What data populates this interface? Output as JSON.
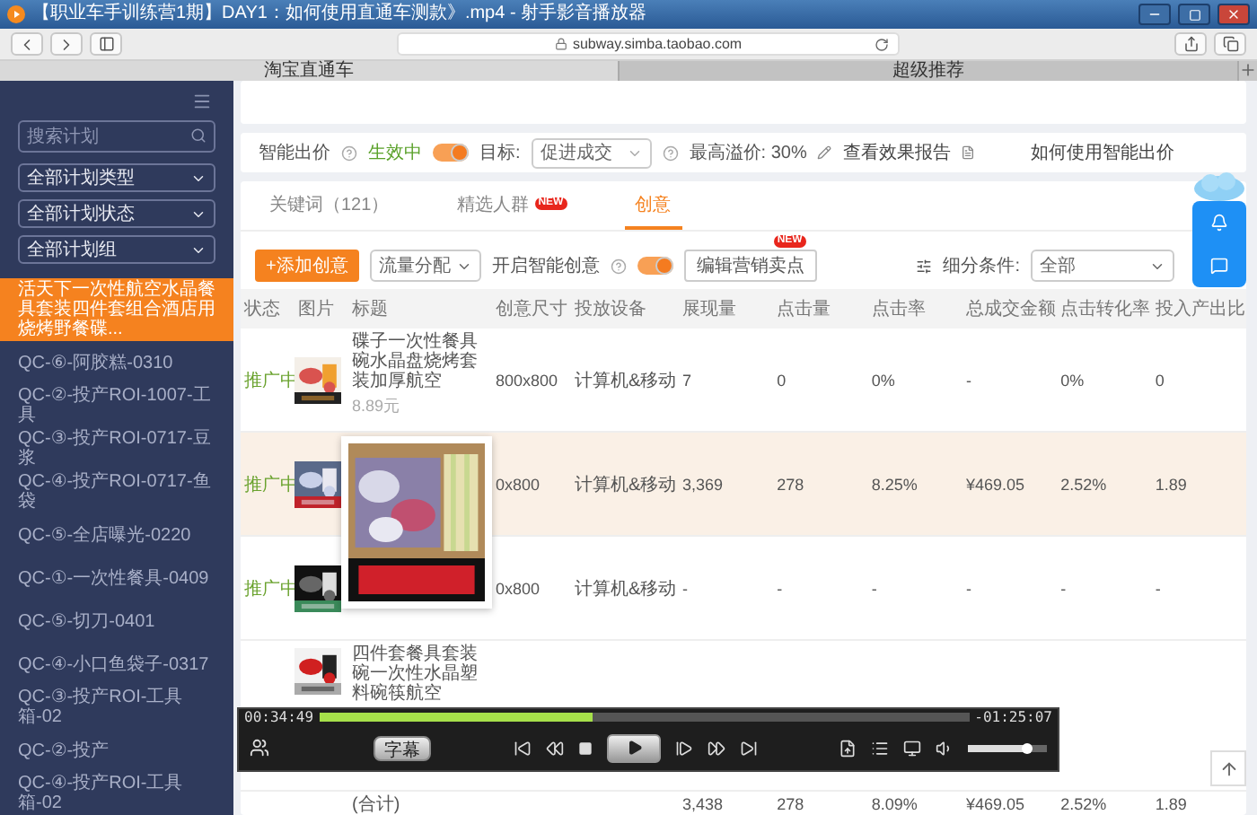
{
  "window": {
    "title": "【职业车手训练营1期】DAY1：如何使用直通车测款》.mp4 - 射手影音播放器"
  },
  "browser": {
    "url": "subway.simba.taobao.com",
    "tabs": [
      {
        "label": "淘宝直通车",
        "selected": true
      },
      {
        "label": "超级推荐",
        "selected": false
      }
    ]
  },
  "sidebar": {
    "search": {
      "placeholder": "搜索计划"
    },
    "filters": [
      "全部计划类型",
      "全部计划状态",
      "全部计划组"
    ],
    "items": [
      {
        "label": "活天下一次性航空水晶餐具套装四件套组合酒店用烧烤野餐碟...",
        "selected": true
      },
      {
        "label": "QC-⑥-阿胶糕-0310",
        "selected": false
      },
      {
        "label": "QC-②-投产ROI-1007-工具",
        "selected": false
      },
      {
        "label": "QC-③-投产ROI-0717-豆浆",
        "selected": false
      },
      {
        "label": "QC-④-投产ROI-0717-鱼袋",
        "selected": false
      },
      {
        "label": "QC-⑤-全店曝光-0220",
        "selected": false
      },
      {
        "label": "QC-①-一次性餐具-0409",
        "selected": false
      },
      {
        "label": "QC-⑤-切刀-0401",
        "selected": false
      },
      {
        "label": "QC-④-小口鱼袋子-0317",
        "selected": false
      },
      {
        "label": "QC-③-投产ROI-工具箱-02",
        "selected": false
      },
      {
        "label": "QC-②-投产",
        "selected": false
      },
      {
        "label": "QC-④-投产ROI-工具箱-02",
        "selected": false
      }
    ]
  },
  "smart_bid": {
    "label": "智能出价",
    "status": "生效中",
    "on": true,
    "goal_label": "目标:",
    "goal": "促进成交",
    "max_premium": "最高溢价: 30%",
    "report_link": "查看效果报告",
    "help_link": "如何使用智能出价"
  },
  "tabs": [
    {
      "label": "关键词（121）",
      "selected": false
    },
    {
      "label": "精选人群",
      "badge": "NEW",
      "selected": false
    },
    {
      "label": "创意",
      "selected": true
    }
  ],
  "toolbar": {
    "add_button": "+添加创意",
    "traffic_select": "流量分配",
    "smart_label": "开启智能创意",
    "smart_on": true,
    "edit_button": "编辑营销卖点",
    "edit_badge": "NEW",
    "filter_label": "细分条件:",
    "filter_value": "全部"
  },
  "table": {
    "columns": [
      "状态",
      "图片",
      "标题",
      "创意尺寸",
      "投放设备",
      "展现量",
      "点击量",
      "点击率",
      "总成交金额",
      "点击转化率",
      "投入产出比"
    ],
    "rows": [
      {
        "status": "推广中",
        "title": "碟子一次性餐具碗水晶盘烧烤套装加厚航空",
        "price": "8.89元",
        "highlighted": false,
        "cells": [
          "800x800",
          "计算机&移动",
          "7",
          "0",
          "0%",
          "-",
          "0%",
          "0"
        ]
      },
      {
        "status": "推广中",
        "highlighted": true,
        "cells": [
          "0x800",
          "计算机&移动",
          "3,369",
          "278",
          "8.25%",
          "¥469.05",
          "2.52%",
          "1.89"
        ]
      },
      {
        "status": "推广中",
        "highlighted": false,
        "cells": [
          "0x800",
          "计算机&移动",
          "-",
          "-",
          "-",
          "-",
          "-",
          "-"
        ]
      },
      {
        "title": "四件套餐具套装碗一次性水晶塑料碗筷航空",
        "highlighted": false
      }
    ],
    "total": {
      "label": "(合计)",
      "cells": [
        "3,438",
        "278",
        "8.09%",
        "¥469.05",
        "2.52%",
        "1.89"
      ]
    }
  },
  "player": {
    "elapsed": "00:34:49",
    "remaining": "-01:25:07",
    "progress": {
      "level": 0.42
    },
    "subtitle_button": "字幕",
    "volume": {
      "level": 0.75
    }
  }
}
